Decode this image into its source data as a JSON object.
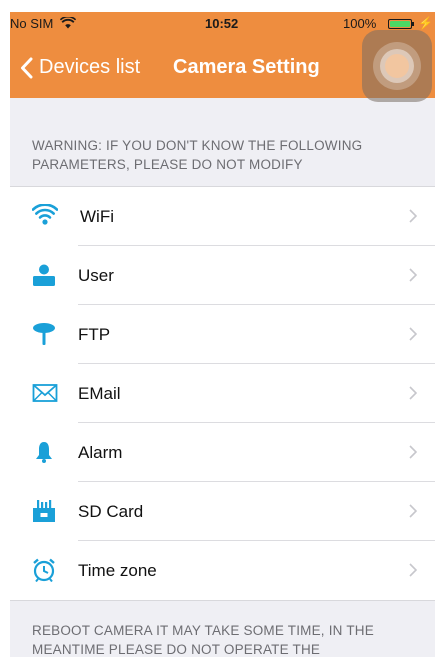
{
  "status_bar": {
    "carrier": "No SIM",
    "time": "10:52",
    "battery_percent": "100%",
    "battery_level": 1.0
  },
  "nav": {
    "back_label": "Devices list",
    "title": "Camera Setting"
  },
  "warning": "WARNING: IF YOU DON'T KNOW THE FOLLOWING PARAMETERS, PLEASE DO NOT MODIFY",
  "settings": [
    {
      "label": "WiFi",
      "icon": "wifi-icon"
    },
    {
      "label": "User",
      "icon": "user-icon"
    },
    {
      "label": "FTP",
      "icon": "ftp-icon"
    },
    {
      "label": "EMail",
      "icon": "envelope-icon"
    },
    {
      "label": "Alarm",
      "icon": "bell-icon"
    },
    {
      "label": "SD Card",
      "icon": "sd-card-icon"
    },
    {
      "label": "Time zone",
      "icon": "alarm-clock-icon"
    }
  ],
  "footer": "REBOOT CAMERA IT MAY TAKE SOME TIME, IN THE MEANTIME PLEASE DO NOT OPERATE THE",
  "colors": {
    "header": "#ee8d3f",
    "icon_accent": "#1aa0d8",
    "background": "#efeff4"
  }
}
